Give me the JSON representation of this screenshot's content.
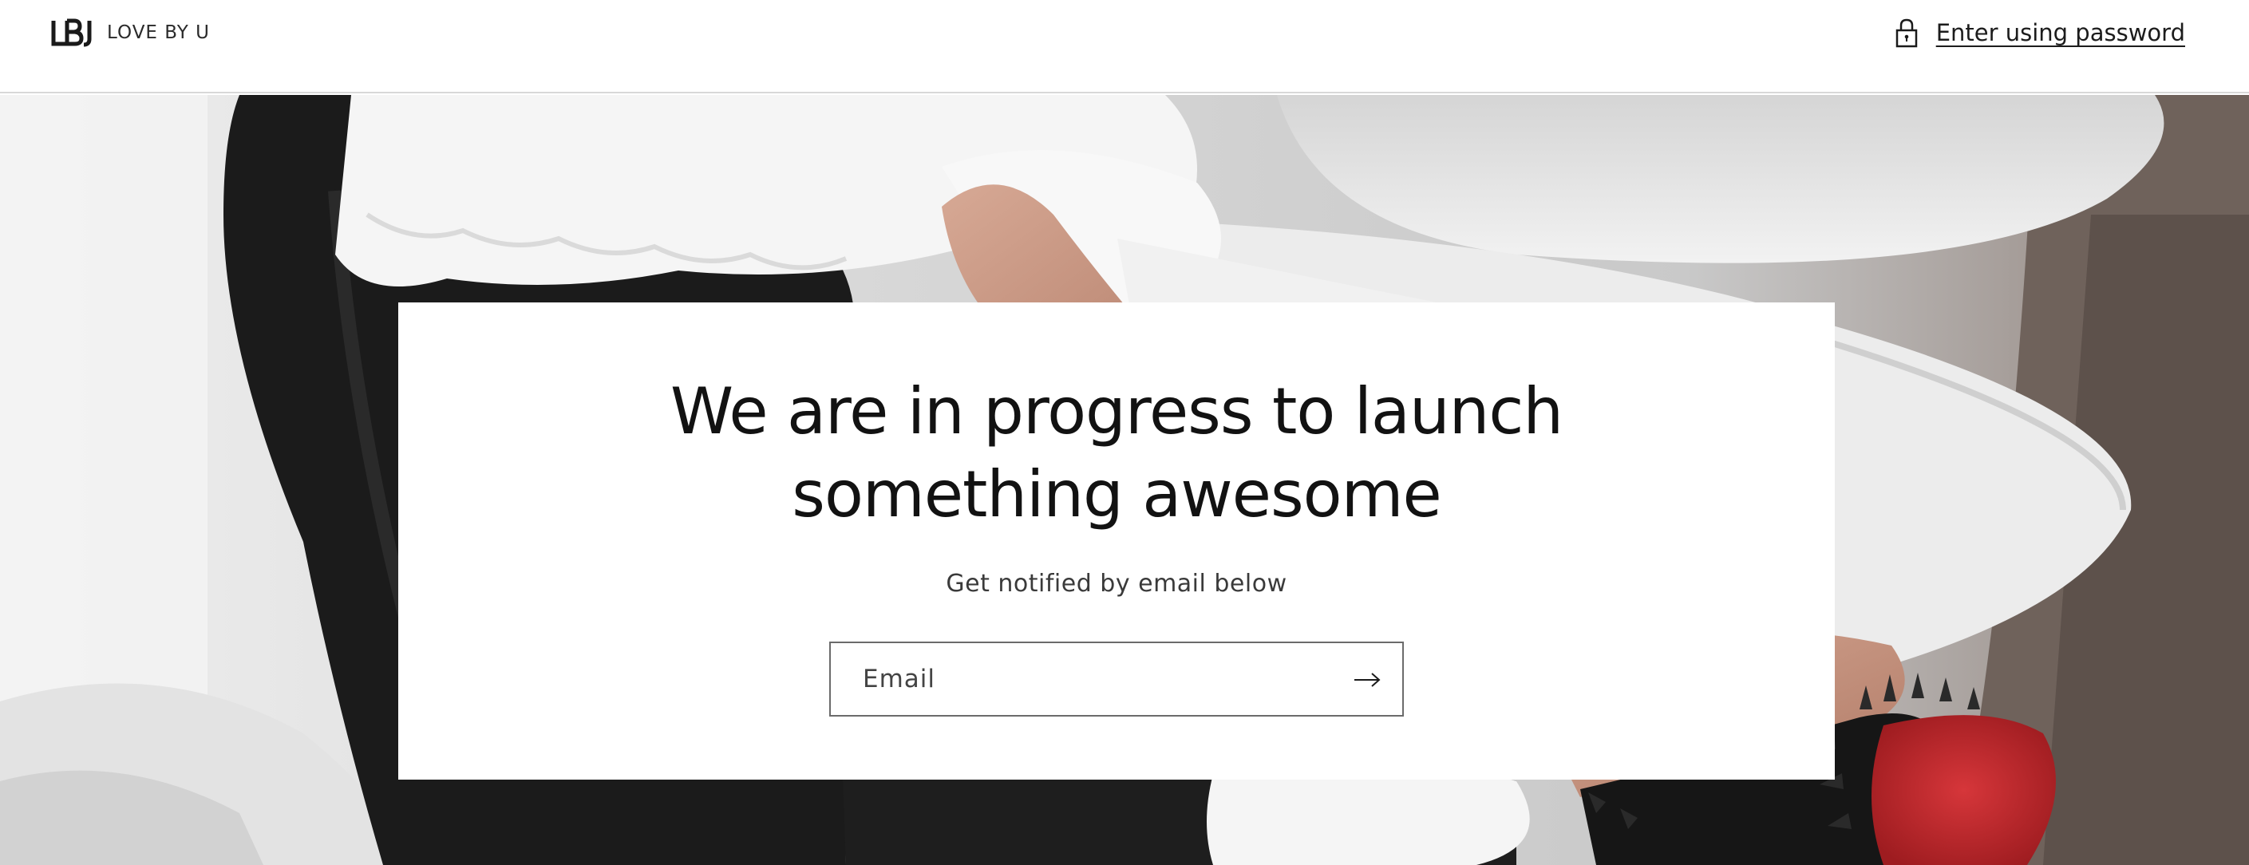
{
  "header": {
    "brand_name": "LOVE BY U",
    "logo_icon": "lbu-logo-icon",
    "password_link_label": "Enter using password",
    "password_icon": "lock-icon"
  },
  "hero": {
    "background_description_icon": "hero-photo",
    "accent_colors": {
      "trousers": "#1c1c1c",
      "blouse": "#f4f4f4",
      "heel_sole": "#c4262c",
      "skin": "#c89580"
    }
  },
  "card": {
    "heading": "We are in progress to launch something awesome",
    "subtext": "Get notified by email below",
    "email_placeholder": "Email",
    "submit_icon": "arrow-right-icon"
  }
}
